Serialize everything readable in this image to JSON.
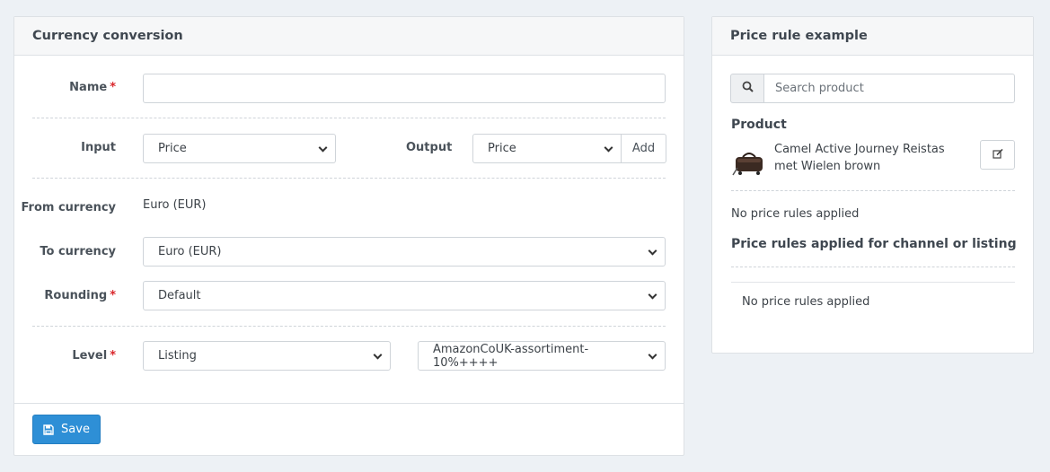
{
  "left_panel": {
    "title": "Currency conversion",
    "name": {
      "label": "Name",
      "value": ""
    },
    "input": {
      "label": "Input",
      "value": "Price"
    },
    "output": {
      "label": "Output",
      "value": "Price",
      "add_label": "Add"
    },
    "from_currency": {
      "label": "From currency",
      "value": "Euro (EUR)"
    },
    "to_currency": {
      "label": "To currency",
      "value": "Euro (EUR)"
    },
    "rounding": {
      "label": "Rounding",
      "value": "Default"
    },
    "level": {
      "label": "Level",
      "value": "Listing",
      "target": "AmazonCoUK-assortiment-10%++++"
    },
    "required_mark": "*",
    "save_label": "Save"
  },
  "right_panel": {
    "title": "Price rule example",
    "search_placeholder": "Search product",
    "product_heading": "Product",
    "product_name": "Camel Active Journey Reistas met Wielen brown",
    "no_rules_text": "No price rules applied",
    "channel_heading": "Price rules applied for channel or listing",
    "channel_no_rules_text": "No price rules applied"
  },
  "colors": {
    "primary": "#2e8fd6",
    "required": "#d9262b",
    "background": "#edf1f5"
  },
  "icons": {
    "save": "floppy-disk-icon",
    "search": "search-icon",
    "edit": "edit-icon",
    "product": "travel-bag-image"
  }
}
